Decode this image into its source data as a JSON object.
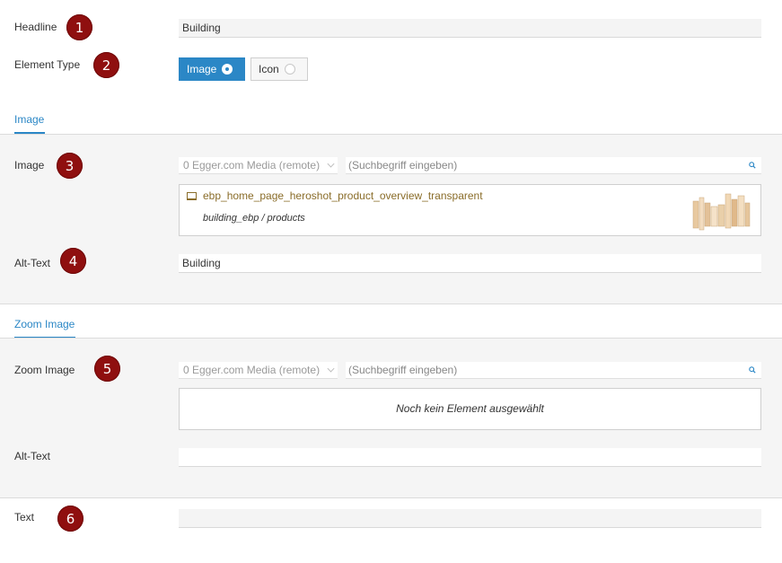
{
  "headline": {
    "label": "Headline",
    "value": "Building",
    "badge": "1"
  },
  "element_type": {
    "label": "Element Type",
    "badge": "2",
    "options": [
      {
        "label": "Image",
        "selected": true
      },
      {
        "label": "Icon",
        "selected": false
      }
    ]
  },
  "image_tab": {
    "tab_label": "Image",
    "image": {
      "label": "Image",
      "badge": "3",
      "source_select": "0 Egger.com Media (remote)",
      "search_placeholder": "(Suchbegriff eingeben)",
      "selected_file": {
        "name": "ebp_home_page_heroshot_product_overview_transparent",
        "path": "building_ebp / products"
      }
    },
    "alt_text": {
      "label": "Alt-Text",
      "badge": "4",
      "value": "Building"
    }
  },
  "zoom_tab": {
    "tab_label": "Zoom Image",
    "zoom_image": {
      "label": "Zoom Image",
      "badge": "5",
      "source_select": "0 Egger.com Media (remote)",
      "search_placeholder": "(Suchbegriff eingeben)",
      "empty_message": "Noch kein Element ausgewählt"
    },
    "alt_text": {
      "label": "Alt-Text",
      "value": ""
    }
  },
  "text_field": {
    "label": "Text",
    "badge": "6",
    "value": ""
  },
  "colors": {
    "accent": "#2b87c6",
    "badge": "#8f0f0f",
    "file_link": "#8a6d2a"
  }
}
